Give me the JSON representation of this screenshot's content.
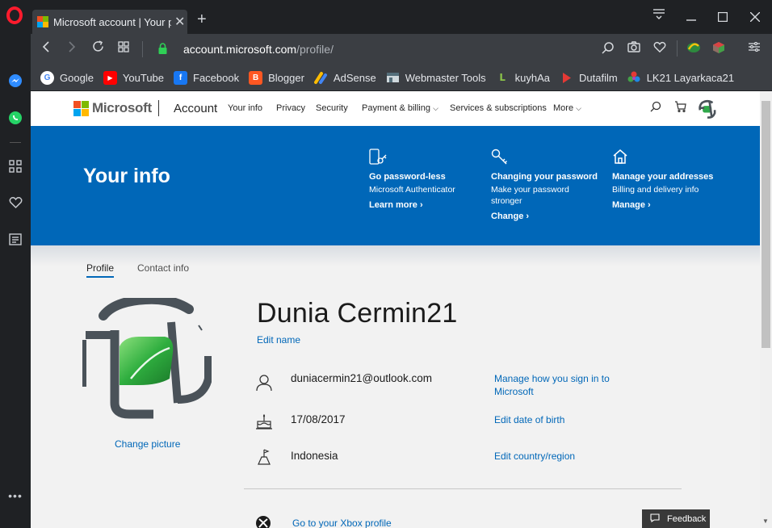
{
  "browser": {
    "tab_title": "Microsoft account | Your pr",
    "new_tab_symbol": "+",
    "url_host": "account.microsoft.com",
    "url_path": "/profile/"
  },
  "bookmarks": [
    {
      "label": "Google",
      "icon": "google-icon",
      "color": "#4285f4"
    },
    {
      "label": "YouTube",
      "icon": "youtube-icon",
      "color": "#ff0000"
    },
    {
      "label": "Facebook",
      "icon": "facebook-icon",
      "color": "#1877f2"
    },
    {
      "label": "Blogger",
      "icon": "blogger-icon",
      "color": "#ff5722"
    },
    {
      "label": "AdSense",
      "icon": "adsense-icon",
      "color": "#fbbc04"
    },
    {
      "label": "Webmaster Tools",
      "icon": "webmaster-icon",
      "color": "#6b7c93"
    },
    {
      "label": "kuyhAa",
      "icon": "kuyhaa-icon",
      "color": "#8bc34a"
    },
    {
      "label": "Dutafilm",
      "icon": "dutafilm-icon",
      "color": "#e53935"
    },
    {
      "label": "LK21 Layarkaca21",
      "icon": "lk21-icon",
      "color": "#ab47bc"
    }
  ],
  "ms_header": {
    "brand": "Microsoft",
    "section": "Account",
    "nav": [
      "Your info",
      "Privacy",
      "Security",
      "Payment & billing",
      "Services & subscriptions",
      "More"
    ]
  },
  "hero": {
    "title": "Your info",
    "promos": [
      {
        "title": "Go password-less",
        "desc": "Microsoft Authenticator",
        "link": "Learn more",
        "icon": "phone-key-icon"
      },
      {
        "title": "Changing your password",
        "desc": "Make your password stronger",
        "link": "Change",
        "icon": "key-icon"
      },
      {
        "title": "Manage your addresses",
        "desc": "Billing and delivery info",
        "link": "Manage",
        "icon": "home-icon"
      }
    ]
  },
  "subtabs": {
    "profile": "Profile",
    "contact": "Contact info"
  },
  "profile": {
    "name": "Dunia Cermin21",
    "edit_name": "Edit name",
    "change_picture": "Change picture",
    "email": "duniacermin21@outlook.com",
    "email_link": "Manage how you sign in to Microsoft",
    "birth_date": "17/08/2017",
    "birth_link": "Edit date of birth",
    "country": "Indonesia",
    "country_link": "Edit country/region",
    "xbox_link": "Go to your Xbox profile"
  },
  "feedback_label": "Feedback",
  "colors": {
    "accent": "#0067b8",
    "hero": "#0067b8",
    "opera_red": "#ff1b2d"
  }
}
